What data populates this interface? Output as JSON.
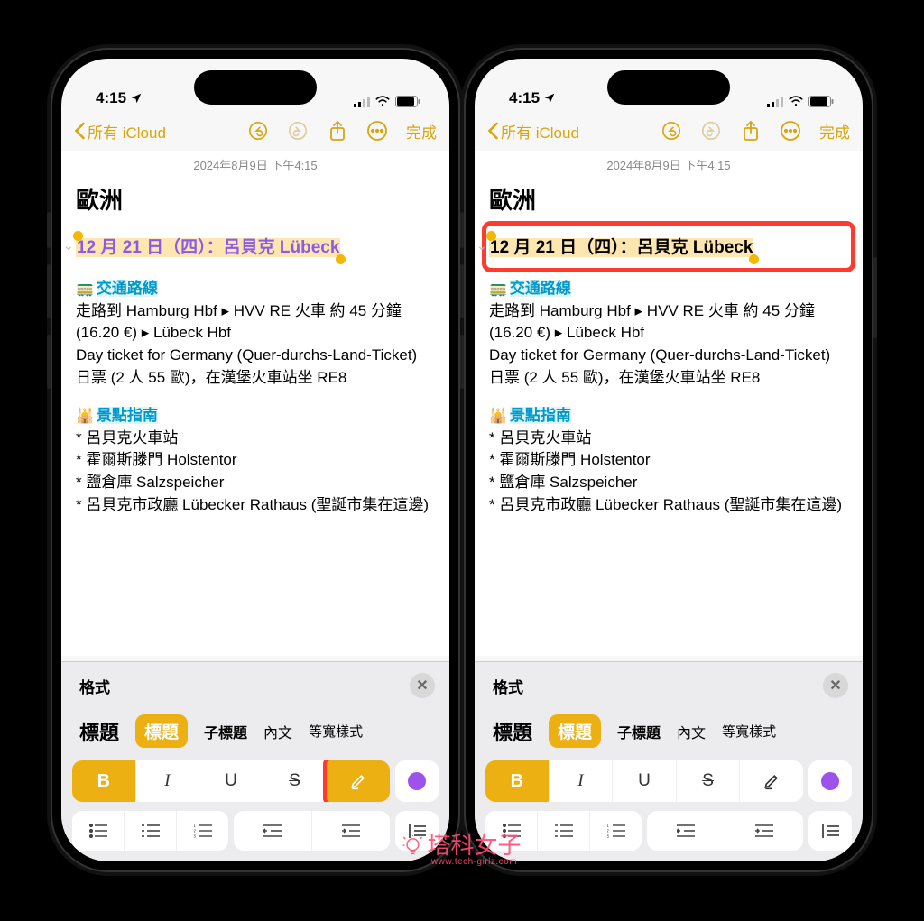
{
  "status": {
    "time": "4:15",
    "location_icon": "location"
  },
  "nav": {
    "back": "所有 iCloud",
    "done": "完成"
  },
  "note": {
    "timestamp": "2024年8月9日 下午4:15",
    "title": "歐洲",
    "heading": "12 月 21 日（四）：呂貝克 Lübeck",
    "sectionA_icon": "🚃",
    "sectionA": "交通路線",
    "bodyA_1": "走路到 Hamburg Hbf ▸ HVV RE 火車 約 45 分鐘 (16.20 €) ▸ Lübeck Hbf",
    "bodyA_2": "Day ticket for Germany (Quer-durchs-Land-Ticket) 日票 (2 人 55 歐)，在漢堡火車站坐 RE8",
    "sectionB_icon": "🕌",
    "sectionB": "景點指南",
    "bodyB_1": "* 呂貝克火車站",
    "bodyB_2": "* 霍爾斯滕門 Holstentor",
    "bodyB_3": "* 鹽倉庫 Salzspeicher",
    "bodyB_4": "* 呂貝克市政廳 Lübecker Rathaus (聖誕市集在這邊)"
  },
  "format": {
    "label": "格式",
    "title": "標題",
    "heading": "標題",
    "subheading": "子標題",
    "body": "內文",
    "mono": "等寬樣式",
    "bold": "B",
    "italic": "I",
    "underline": "U",
    "strike": "S"
  },
  "watermark": {
    "text": "塔科女子",
    "sub": "www.tech-girlz.com"
  }
}
